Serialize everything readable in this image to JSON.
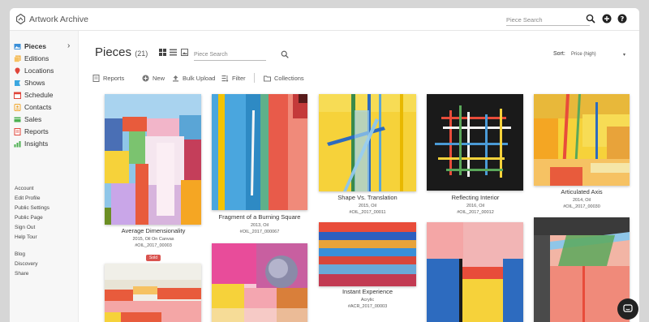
{
  "app": {
    "name": "Artwork Archive"
  },
  "topbar": {
    "search_placeholder": "Piece Search",
    "icons": [
      "search-icon",
      "add-circle-icon",
      "help-icon"
    ]
  },
  "sidebar": {
    "items": [
      {
        "label": "Pieces",
        "icon": "pieces-icon",
        "color": "#3a8fd8",
        "active": true
      },
      {
        "label": "Editions",
        "icon": "editions-icon",
        "color": "#f0a830"
      },
      {
        "label": "Locations",
        "icon": "location-pin-icon",
        "color": "#e0453a"
      },
      {
        "label": "Shows",
        "icon": "shows-icon",
        "color": "#3aa7e0"
      },
      {
        "label": "Schedule",
        "icon": "calendar-icon",
        "color": "#e0453a"
      },
      {
        "label": "Contacts",
        "icon": "contacts-icon",
        "color": "#f0a830"
      },
      {
        "label": "Sales",
        "icon": "sales-icon",
        "color": "#4caf50"
      },
      {
        "label": "Reports",
        "icon": "reports-icon",
        "color": "#e0453a"
      },
      {
        "label": "Insights",
        "icon": "insights-icon",
        "color": "#4caf50"
      }
    ],
    "account_links": [
      "Account",
      "Edit Profile",
      "Public Settings",
      "Public Page",
      "Sign Out",
      "Help Tour"
    ],
    "extra_links": [
      "Blog",
      "Discovery",
      "Share"
    ]
  },
  "main": {
    "title": "Pieces",
    "count": "(21)",
    "search_placeholder": "Piece Search",
    "sort_label": "Sort:",
    "sort_value": "Price (high)",
    "toolbar": [
      {
        "label": "Reports",
        "icon": "reports-icon"
      },
      {
        "label": "New",
        "icon": "plus-circle-icon"
      },
      {
        "label": "Bulk Upload",
        "icon": "upload-icon"
      },
      {
        "label": "Filter",
        "icon": "filter-icon"
      },
      {
        "label": "Collections",
        "icon": "folder-icon"
      }
    ]
  },
  "pieces": [
    {
      "title": "Average Dimensionality",
      "meta": "2015, Oil On Canvas",
      "id": "#OIL_2017_00003",
      "badge": "Sold"
    },
    {
      "title": "Fragment of a Burning Square",
      "meta": "2013, Oil",
      "id": "#OIL_2017_000067"
    },
    {
      "title": "Shape Vs. Translation",
      "meta": "2015, Oil",
      "id": "#OIL_2017_00011"
    },
    {
      "title": "Reflecting Interior",
      "meta": "2016, Oil",
      "id": "#OIL_2017_00012"
    },
    {
      "title": "Articulated Axis",
      "meta": "2014, Oil",
      "id": "#OIL_2017_00030"
    },
    {
      "title": "Instant Experience",
      "meta": "Acrylic",
      "id": "#ACR_2017_00003"
    }
  ]
}
